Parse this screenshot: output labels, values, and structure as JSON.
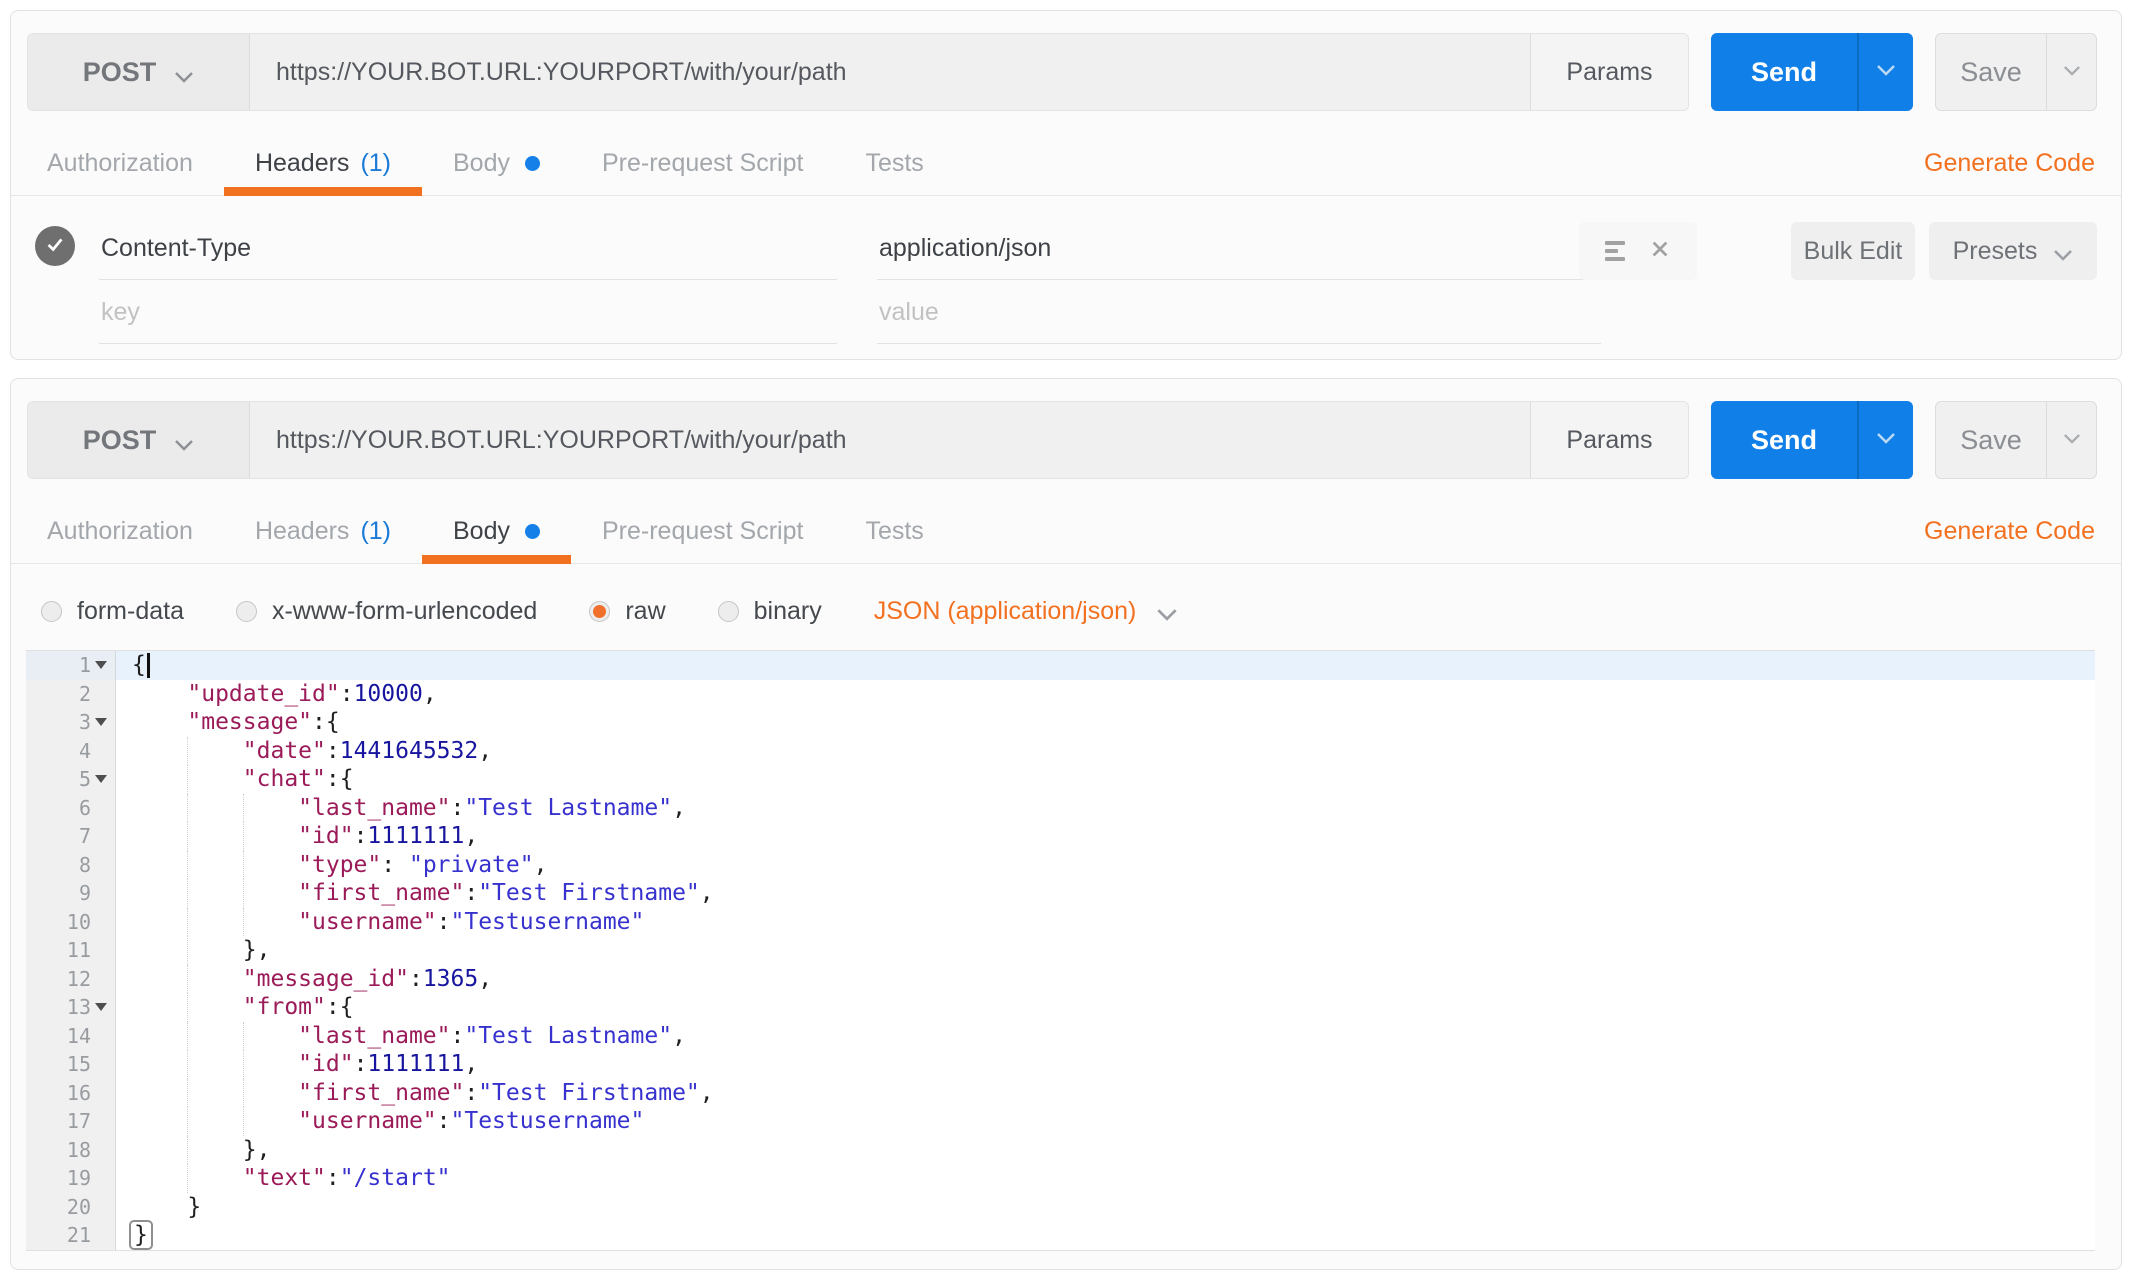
{
  "colors": {
    "accent_orange": "#F27121",
    "accent_blue": "#1580E8",
    "send_blue": "#1080E8",
    "json_key": "#9B1B59",
    "json_string": "#3732CE",
    "json_number": "#17159E"
  },
  "panels": [
    {
      "method": "POST",
      "url": "https://YOUR.BOT.URL:YOURPORT/with/your/path",
      "params_label": "Params",
      "send_label": "Send",
      "save_label": "Save",
      "generate_code_label": "Generate Code",
      "active_tab": "Headers",
      "tabs": [
        {
          "label": "Authorization"
        },
        {
          "label": "Headers",
          "count": "(1)"
        },
        {
          "label": "Body",
          "dot": true
        },
        {
          "label": "Pre-request Script"
        },
        {
          "label": "Tests"
        }
      ],
      "headers_editor": {
        "rows": [
          {
            "checked": true,
            "key": "Content-Type",
            "value": "application/json"
          }
        ],
        "key_placeholder": "key",
        "value_placeholder": "value",
        "bulk_edit_label": "Bulk Edit",
        "presets_label": "Presets"
      }
    },
    {
      "method": "POST",
      "url": "https://YOUR.BOT.URL:YOURPORT/with/your/path",
      "params_label": "Params",
      "send_label": "Send",
      "save_label": "Save",
      "generate_code_label": "Generate Code",
      "active_tab": "Body",
      "tabs": [
        {
          "label": "Authorization"
        },
        {
          "label": "Headers",
          "count": "(1)"
        },
        {
          "label": "Body",
          "dot": true
        },
        {
          "label": "Pre-request Script"
        },
        {
          "label": "Tests"
        }
      ],
      "body_editor": {
        "modes": [
          {
            "label": "form-data"
          },
          {
            "label": "x-www-form-urlencoded"
          },
          {
            "label": "raw",
            "selected": true
          },
          {
            "label": "binary"
          }
        ],
        "type_label": "JSON (application/json)",
        "code_lines": [
          {
            "n": 1,
            "indent": 0,
            "fold": true,
            "active": true,
            "cursor": true,
            "tokens": [
              {
                "t": "p",
                "v": "{"
              }
            ]
          },
          {
            "n": 2,
            "indent": 4,
            "tokens": [
              {
                "t": "k",
                "v": "\"update_id\""
              },
              {
                "t": "p",
                "v": ":"
              },
              {
                "t": "n",
                "v": "10000"
              },
              {
                "t": "p",
                "v": ","
              }
            ]
          },
          {
            "n": 3,
            "indent": 4,
            "fold": true,
            "tokens": [
              {
                "t": "k",
                "v": "\"message\""
              },
              {
                "t": "p",
                "v": ":{"
              }
            ]
          },
          {
            "n": 4,
            "indent": 8,
            "tokens": [
              {
                "t": "k",
                "v": "\"date\""
              },
              {
                "t": "p",
                "v": ":"
              },
              {
                "t": "n",
                "v": "1441645532"
              },
              {
                "t": "p",
                "v": ","
              }
            ]
          },
          {
            "n": 5,
            "indent": 8,
            "fold": true,
            "tokens": [
              {
                "t": "k",
                "v": "\"chat\""
              },
              {
                "t": "p",
                "v": ":{"
              }
            ]
          },
          {
            "n": 6,
            "indent": 12,
            "tokens": [
              {
                "t": "k",
                "v": "\"last_name\""
              },
              {
                "t": "p",
                "v": ":"
              },
              {
                "t": "s",
                "v": "\"Test Lastname\""
              },
              {
                "t": "p",
                "v": ","
              }
            ]
          },
          {
            "n": 7,
            "indent": 12,
            "tokens": [
              {
                "t": "k",
                "v": "\"id\""
              },
              {
                "t": "p",
                "v": ":"
              },
              {
                "t": "n",
                "v": "1111111"
              },
              {
                "t": "p",
                "v": ","
              }
            ]
          },
          {
            "n": 8,
            "indent": 12,
            "tokens": [
              {
                "t": "k",
                "v": "\"type\""
              },
              {
                "t": "p",
                "v": ": "
              },
              {
                "t": "s",
                "v": "\"private\""
              },
              {
                "t": "p",
                "v": ","
              }
            ]
          },
          {
            "n": 9,
            "indent": 12,
            "tokens": [
              {
                "t": "k",
                "v": "\"first_name\""
              },
              {
                "t": "p",
                "v": ":"
              },
              {
                "t": "s",
                "v": "\"Test Firstname\""
              },
              {
                "t": "p",
                "v": ","
              }
            ]
          },
          {
            "n": 10,
            "indent": 12,
            "tokens": [
              {
                "t": "k",
                "v": "\"username\""
              },
              {
                "t": "p",
                "v": ":"
              },
              {
                "t": "s",
                "v": "\"Testusername\""
              }
            ]
          },
          {
            "n": 11,
            "indent": 8,
            "tokens": [
              {
                "t": "p",
                "v": "},"
              }
            ]
          },
          {
            "n": 12,
            "indent": 8,
            "tokens": [
              {
                "t": "k",
                "v": "\"message_id\""
              },
              {
                "t": "p",
                "v": ":"
              },
              {
                "t": "n",
                "v": "1365"
              },
              {
                "t": "p",
                "v": ","
              }
            ]
          },
          {
            "n": 13,
            "indent": 8,
            "fold": true,
            "tokens": [
              {
                "t": "k",
                "v": "\"from\""
              },
              {
                "t": "p",
                "v": ":{"
              }
            ]
          },
          {
            "n": 14,
            "indent": 12,
            "tokens": [
              {
                "t": "k",
                "v": "\"last_name\""
              },
              {
                "t": "p",
                "v": ":"
              },
              {
                "t": "s",
                "v": "\"Test Lastname\""
              },
              {
                "t": "p",
                "v": ","
              }
            ]
          },
          {
            "n": 15,
            "indent": 12,
            "tokens": [
              {
                "t": "k",
                "v": "\"id\""
              },
              {
                "t": "p",
                "v": ":"
              },
              {
                "t": "n",
                "v": "1111111"
              },
              {
                "t": "p",
                "v": ","
              }
            ]
          },
          {
            "n": 16,
            "indent": 12,
            "tokens": [
              {
                "t": "k",
                "v": "\"first_name\""
              },
              {
                "t": "p",
                "v": ":"
              },
              {
                "t": "s",
                "v": "\"Test Firstname\""
              },
              {
                "t": "p",
                "v": ","
              }
            ]
          },
          {
            "n": 17,
            "indent": 12,
            "tokens": [
              {
                "t": "k",
                "v": "\"username\""
              },
              {
                "t": "p",
                "v": ":"
              },
              {
                "t": "s",
                "v": "\"Testusername\""
              }
            ]
          },
          {
            "n": 18,
            "indent": 8,
            "tokens": [
              {
                "t": "p",
                "v": "},"
              }
            ]
          },
          {
            "n": 19,
            "indent": 8,
            "tokens": [
              {
                "t": "k",
                "v": "\"text\""
              },
              {
                "t": "p",
                "v": ":"
              },
              {
                "t": "s",
                "v": "\"/start\""
              }
            ]
          },
          {
            "n": 20,
            "indent": 4,
            "tokens": [
              {
                "t": "p",
                "v": "}"
              }
            ]
          },
          {
            "n": 21,
            "indent": 0,
            "tokens": [
              {
                "t": "p",
                "v": "}",
                "box": true
              }
            ]
          }
        ]
      }
    }
  ]
}
